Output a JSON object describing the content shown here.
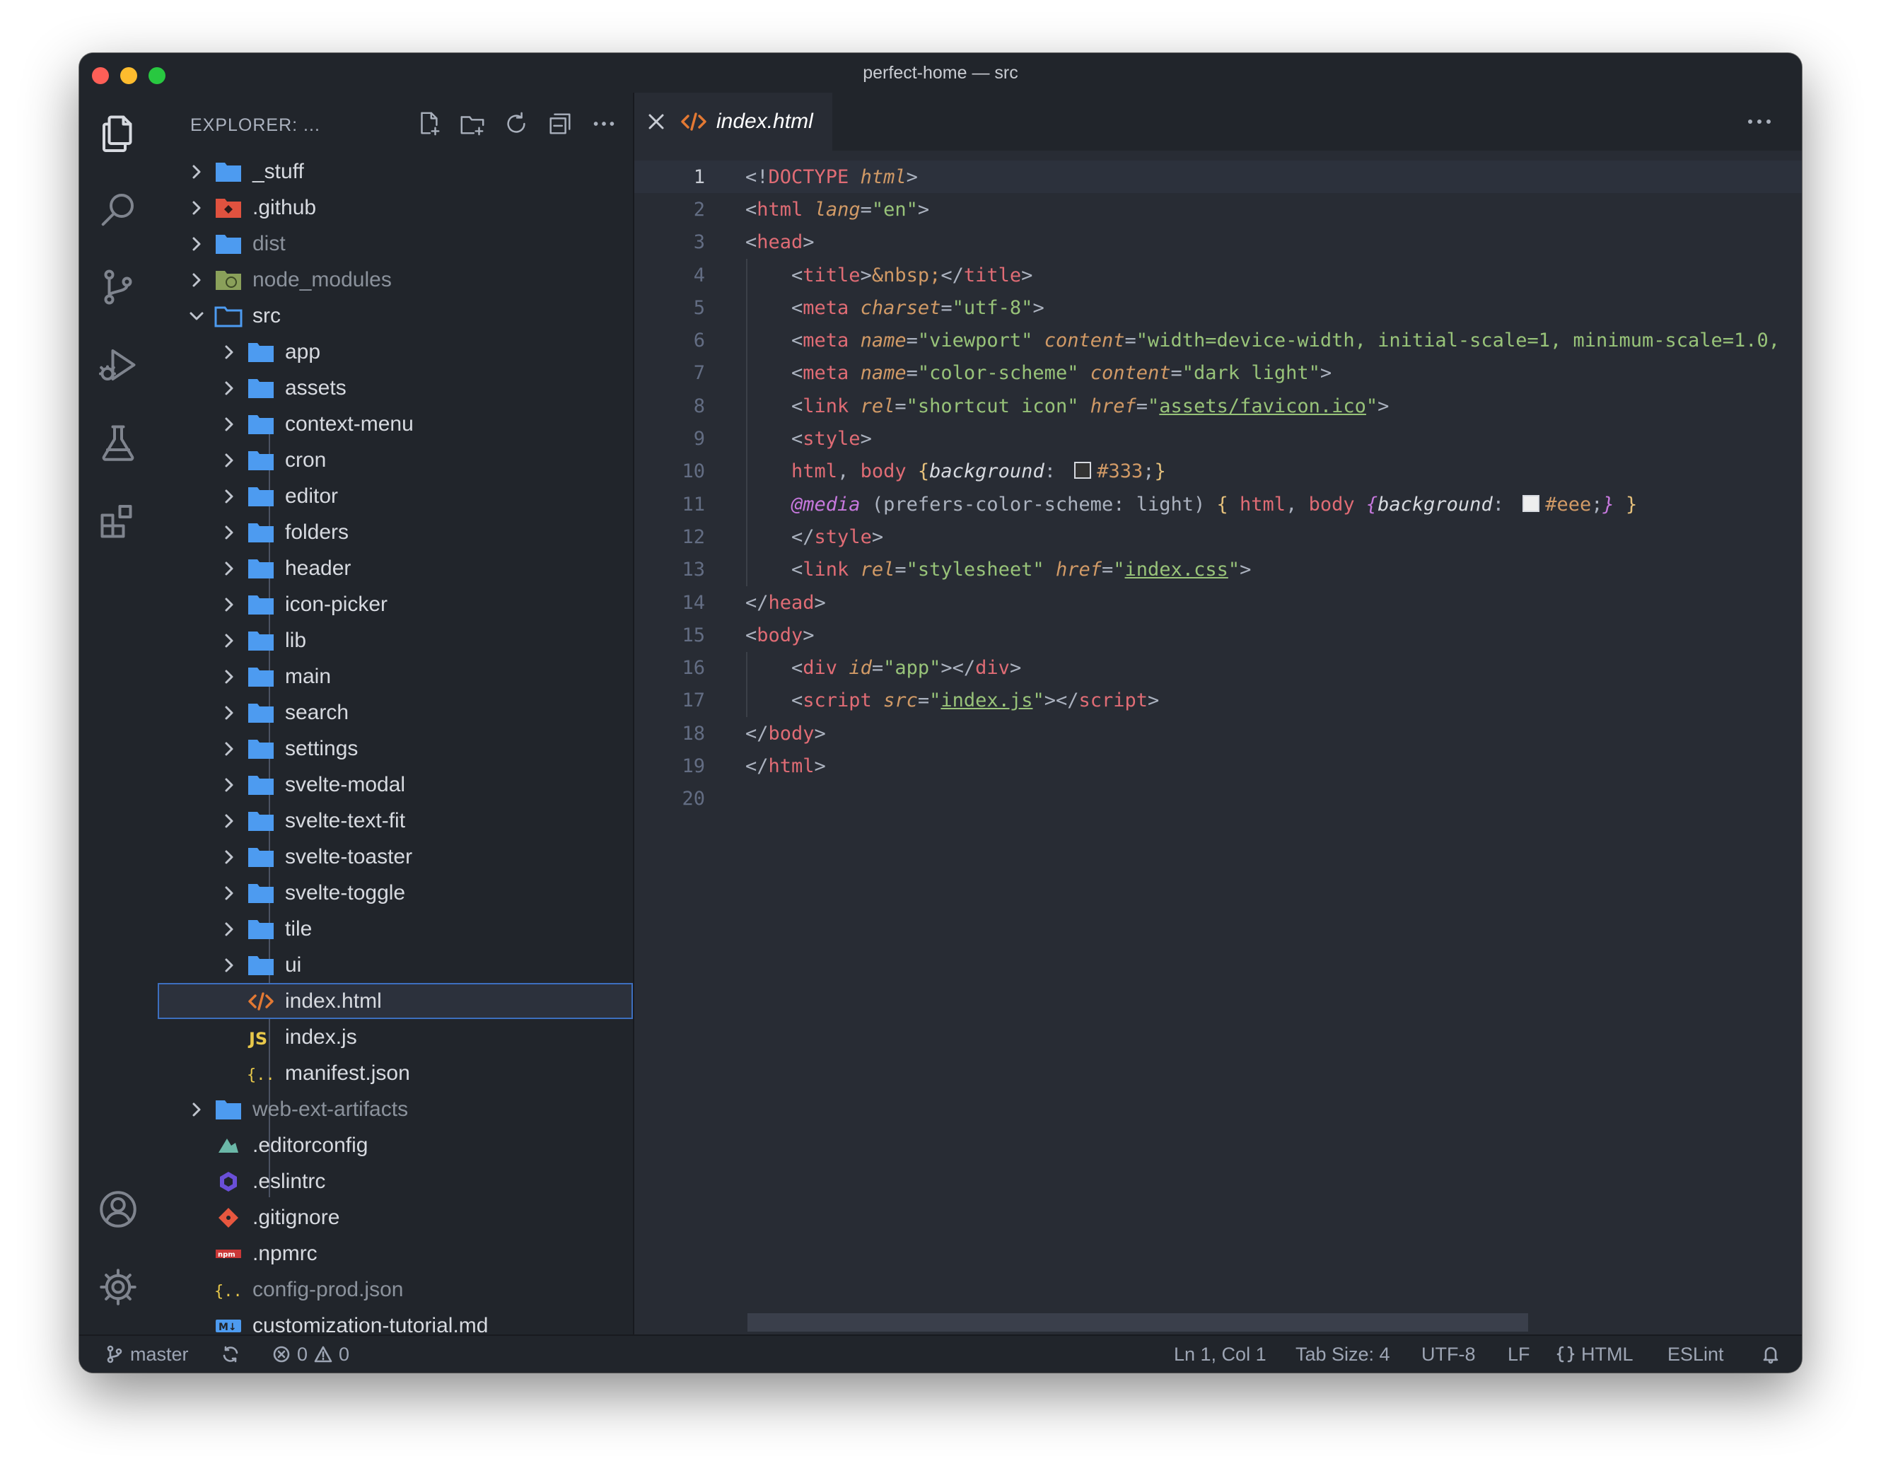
{
  "window_title": "perfect-home — src",
  "sidebar": {
    "title": "EXPLORER: ...",
    "actions": [
      "new-file-icon",
      "new-folder-icon",
      "refresh-icon",
      "collapse-all-icon",
      "more-icon"
    ]
  },
  "tree": {
    "root": [
      {
        "label": "_stuff",
        "kind": "folder"
      },
      {
        "label": ".github",
        "kind": "folder-github"
      },
      {
        "label": "dist",
        "kind": "folder",
        "dim": true
      },
      {
        "label": "node_modules",
        "kind": "folder-node",
        "dim": true
      },
      {
        "label": "src",
        "kind": "folder-open"
      }
    ],
    "src": [
      "app",
      "assets",
      "context-menu",
      "cron",
      "editor",
      "folders",
      "header",
      "icon-picker",
      "lib",
      "main",
      "search",
      "settings",
      "svelte-modal",
      "svelte-text-fit",
      "svelte-toaster",
      "svelte-toggle",
      "tile",
      "ui"
    ],
    "src_files": [
      {
        "label": "index.html",
        "kind": "html",
        "selected": true
      },
      {
        "label": "index.js",
        "kind": "js"
      },
      {
        "label": "manifest.json",
        "kind": "json"
      }
    ],
    "after": [
      {
        "label": "web-ext-artifacts",
        "kind": "folder",
        "dim": true
      },
      {
        "label": ".editorconfig",
        "kind": "editorconfig"
      },
      {
        "label": ".eslintrc",
        "kind": "eslint"
      },
      {
        "label": ".gitignore",
        "kind": "git"
      },
      {
        "label": ".npmrc",
        "kind": "npm"
      },
      {
        "label": "config-prod.json",
        "kind": "json",
        "dim": true
      },
      {
        "label": "customization-tutorial.md",
        "kind": "markdown"
      }
    ]
  },
  "tab": {
    "label": "index.html",
    "icon": "html-icon"
  },
  "colors": {
    "accent": "#3d6fbf",
    "folder": "#4d9bf0",
    "tag": "#e06c75",
    "attr": "#d19a66",
    "string": "#98c379"
  },
  "code": {
    "line_numbers": [
      "1",
      "2",
      "3",
      "4",
      "5",
      "6",
      "7",
      "8",
      "9",
      "10",
      "11",
      "12",
      "13",
      "14",
      "15",
      "16",
      "17",
      "18",
      "19",
      "20"
    ],
    "l1": [
      "<!",
      "DOCTYPE",
      " ",
      "html",
      ">"
    ],
    "l2": [
      "<",
      "html",
      " ",
      "lang",
      "=",
      "\"en\"",
      ">"
    ],
    "l3": [
      "<",
      "head",
      ">"
    ],
    "l4": [
      "    <",
      "title",
      ">",
      "&nbsp;",
      "</",
      "title",
      ">"
    ],
    "l5": [
      "    <",
      "meta",
      " ",
      "charset",
      "=",
      "\"utf-8\"",
      ">"
    ],
    "l6": [
      "    <",
      "meta",
      " ",
      "name",
      "=",
      "\"viewport\"",
      " ",
      "content",
      "=",
      "\"width=device-width, initial-scale=1, minimum-scale=1.0,"
    ],
    "l7": [
      "    <",
      "meta",
      " ",
      "name",
      "=",
      "\"color-scheme\"",
      " ",
      "content",
      "=",
      "\"dark light\"",
      ">"
    ],
    "l8": [
      "    <",
      "link",
      " ",
      "rel",
      "=",
      "\"shortcut icon\"",
      " ",
      "href",
      "=",
      "\"",
      "assets/favicon.ico",
      "\"",
      ">"
    ],
    "l9": [
      "    <",
      "style",
      ">"
    ],
    "l10": [
      "    ",
      "html",
      ", ",
      "body",
      " ",
      "{",
      "background",
      ": ",
      "#333",
      ";",
      "}"
    ],
    "l11": [
      "    ",
      "@media",
      " (prefers-color-scheme: light) ",
      "{",
      " ",
      "html",
      ", ",
      "body",
      " ",
      "{",
      "background",
      ": ",
      "#eee",
      ";",
      "}",
      " ",
      "}"
    ],
    "l12": [
      "    </",
      "style",
      ">"
    ],
    "l13": [
      "    <",
      "link",
      " ",
      "rel",
      "=",
      "\"stylesheet\"",
      " ",
      "href",
      "=",
      "\"",
      "index.css",
      "\"",
      ">"
    ],
    "l14": [
      "</",
      "head",
      ">"
    ],
    "l15": [
      "<",
      "body",
      ">"
    ],
    "l16": [
      "    <",
      "div",
      " ",
      "id",
      "=",
      "\"app\"",
      "></",
      "div",
      ">"
    ],
    "l17": [
      "    <",
      "script",
      " ",
      "src",
      "=",
      "\"",
      "index.js",
      "\"",
      "></",
      "script",
      ">"
    ],
    "l18": [
      "</",
      "body",
      ">"
    ],
    "l19": [
      "</",
      "html",
      ">"
    ],
    "swatch_dark": "#333333",
    "swatch_light": "#eeeeee"
  },
  "status": {
    "branch": "master",
    "errors": "0",
    "warnings": "0",
    "cursor": "Ln 1, Col 1",
    "tab_size": "Tab Size: 4",
    "encoding": "UTF-8",
    "eol": "LF",
    "language": "HTML",
    "linter": "ESLint"
  }
}
